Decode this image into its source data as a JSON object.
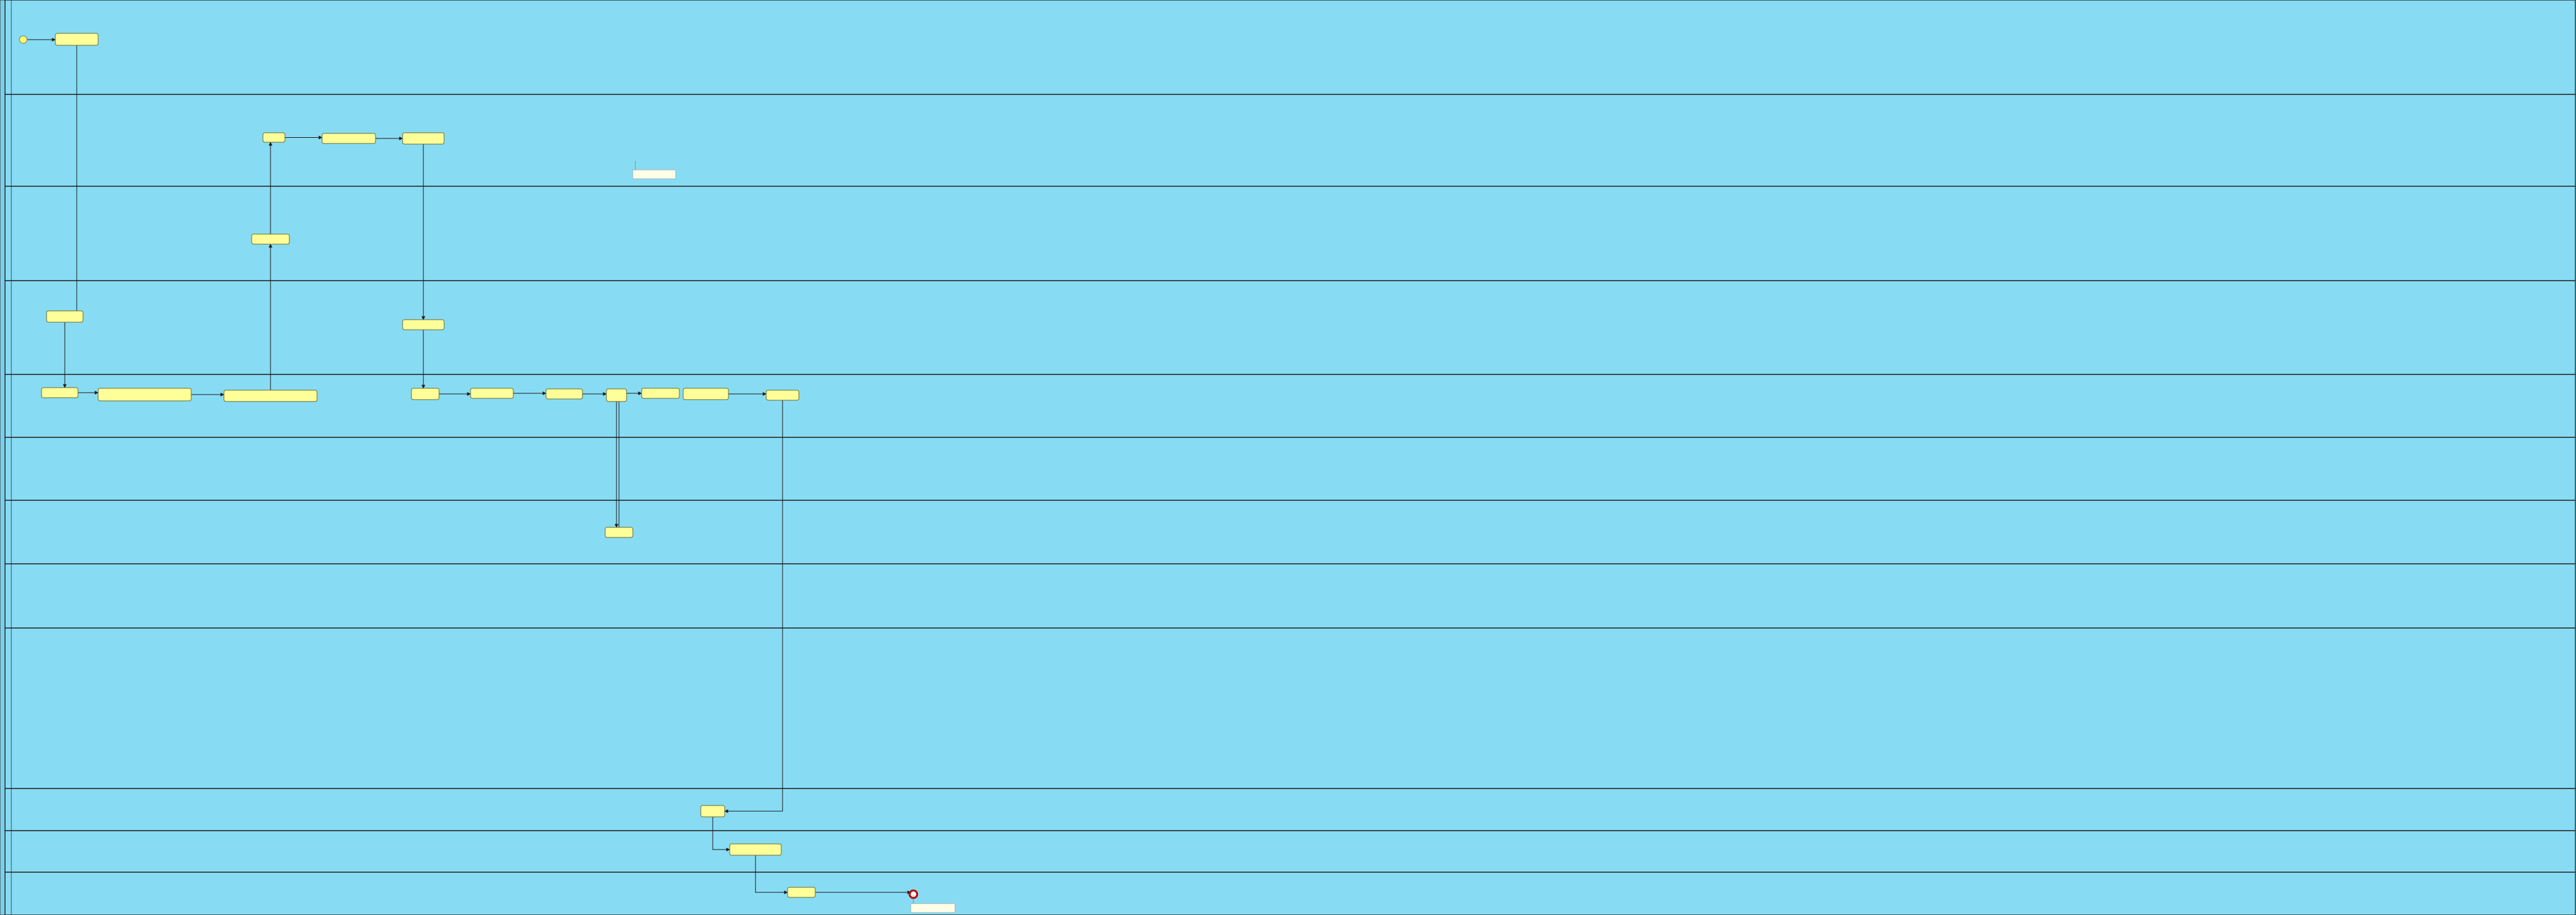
{
  "colors": {
    "lane_fill": "#87DCF4",
    "lane_stroke": "#2b2b2b",
    "pool_header_fill": "#7BCFEA",
    "task_fill": "#FFFF99",
    "task_stroke": "#6b6b2e",
    "edge": "#1a1a1a",
    "start_fill": "#FFFF66",
    "end_stroke": "#C00000",
    "note_fill": "#FFFFE8"
  },
  "pool": {
    "label": ""
  },
  "lanes": [
    {
      "id": "l1",
      "label": ""
    },
    {
      "id": "l2",
      "label": ""
    },
    {
      "id": "l3",
      "label": ""
    },
    {
      "id": "l4",
      "label": ""
    },
    {
      "id": "l5",
      "label": ""
    },
    {
      "id": "l6",
      "label": ""
    },
    {
      "id": "l7",
      "label": ""
    },
    {
      "id": "l8",
      "label": ""
    },
    {
      "id": "l9",
      "label": ""
    },
    {
      "id": "l10",
      "label": ""
    },
    {
      "id": "l11",
      "label": ""
    },
    {
      "id": "l12",
      "label": ""
    }
  ],
  "tasks": [
    {
      "id": "t1",
      "label": ""
    },
    {
      "id": "t2",
      "label": ""
    },
    {
      "id": "t3",
      "label": ""
    },
    {
      "id": "t4",
      "label": ""
    },
    {
      "id": "t5",
      "label": ""
    },
    {
      "id": "t6",
      "label": ""
    },
    {
      "id": "t7",
      "label": ""
    },
    {
      "id": "t8",
      "label": ""
    },
    {
      "id": "t9",
      "label": ""
    },
    {
      "id": "t10",
      "label": ""
    },
    {
      "id": "t11",
      "label": ""
    },
    {
      "id": "t12",
      "label": ""
    },
    {
      "id": "t13",
      "label": ""
    },
    {
      "id": "t14",
      "label": ""
    },
    {
      "id": "t15",
      "label": ""
    },
    {
      "id": "t16",
      "label": ""
    },
    {
      "id": "t17",
      "label": ""
    },
    {
      "id": "t18",
      "label": ""
    },
    {
      "id": "t19",
      "label": ""
    },
    {
      "id": "t20",
      "label": ""
    },
    {
      "id": "t21",
      "label": ""
    },
    {
      "id": "t22",
      "label": ""
    },
    {
      "id": "t23",
      "label": ""
    }
  ],
  "notes": [
    {
      "id": "n1",
      "label": ""
    },
    {
      "id": "n2",
      "label": ""
    }
  ],
  "edges": [
    {
      "from": "start",
      "to": "t1"
    },
    {
      "from": "t1",
      "to": "t9"
    },
    {
      "from": "t9",
      "to": "t10"
    },
    {
      "from": "t10",
      "to": "t11"
    },
    {
      "from": "t11",
      "to": "t12"
    },
    {
      "from": "t12",
      "to": "t8"
    },
    {
      "from": "t8",
      "to": "t2"
    },
    {
      "from": "t2",
      "to": "t3"
    },
    {
      "from": "t3",
      "to": "t4"
    },
    {
      "from": "t4",
      "to": "t13"
    },
    {
      "from": "t13",
      "to": "t14"
    },
    {
      "from": "t14",
      "to": "t15"
    },
    {
      "from": "t15",
      "to": "t16"
    },
    {
      "from": "t16",
      "to": "t17"
    },
    {
      "from": "t17",
      "to": "t20"
    },
    {
      "from": "t20",
      "to": "t18"
    },
    {
      "from": "t19",
      "to": "t21"
    },
    {
      "from": "t21",
      "to": "t22"
    },
    {
      "from": "t22",
      "to": "t23"
    },
    {
      "from": "t23",
      "to": "t5"
    },
    {
      "from": "t5",
      "to": "t6"
    },
    {
      "from": "t6",
      "to": "end"
    }
  ]
}
